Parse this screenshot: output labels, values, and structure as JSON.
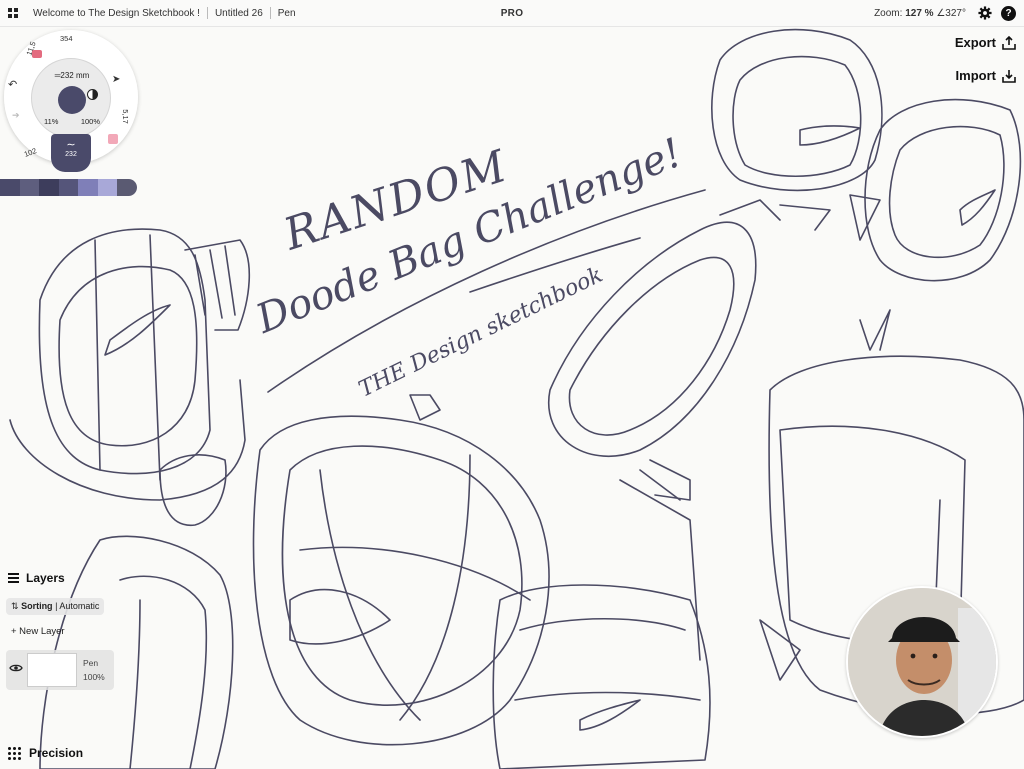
{
  "topbar": {
    "apps_icon": "grid-icon",
    "breadcrumbs": [
      "Welcome to The Design Sketchbook !",
      "Untitled 26",
      "Pen"
    ],
    "badge": "PRO",
    "zoom_label": "Zoom:",
    "zoom_value": "127 %",
    "rotation_value": "∠327°",
    "settings_icon": "gear-icon",
    "help_label": "?"
  },
  "actions": {
    "export_label": "Export",
    "import_label": "Import"
  },
  "tool_wheel": {
    "size": "═232 mm",
    "opacity": "11%",
    "smoothing": "100%",
    "top_value": "354",
    "left_value": "11,5",
    "right_value": "5,17",
    "bottom_left_value": "102",
    "brush_value": "232",
    "brush_color": "#4a4a6a",
    "swatches": [
      "#4a4a6a",
      "#5e5e7e",
      "#3d3d5c",
      "#55557a",
      "#7f7fb8",
      "#a8a8d8",
      "#5a5a72"
    ]
  },
  "canvas": {
    "handwriting_line1": "RANDOM",
    "handwriting_line2": "Doode Bag Challenge!",
    "handwriting_line3": "THE Design sketchbook",
    "ink_color": "#4b4a63"
  },
  "layers": {
    "title": "Layers",
    "sorting_label": "Sorting",
    "sorting_value": "Automatic",
    "new_layer_label": "+ New Layer",
    "items": [
      {
        "name": "Pen",
        "opacity": "100%"
      }
    ]
  },
  "precision": {
    "label": "Precision"
  }
}
